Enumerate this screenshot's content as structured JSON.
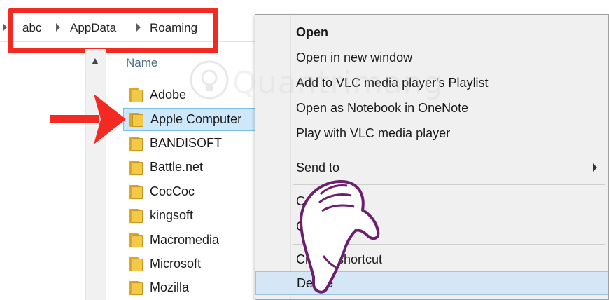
{
  "breadcrumb": {
    "items": [
      "abc",
      "AppData",
      "Roaming"
    ]
  },
  "file_list": {
    "column_header": "Name",
    "items": [
      {
        "name": "Adobe",
        "selected": false
      },
      {
        "name": "Apple Computer",
        "selected": true
      },
      {
        "name": "BANDISOFT",
        "selected": false
      },
      {
        "name": "Battle.net",
        "selected": false
      },
      {
        "name": "CocCoc",
        "selected": false
      },
      {
        "name": "kingsoft",
        "selected": false
      },
      {
        "name": "Macromedia",
        "selected": false
      },
      {
        "name": "Microsoft",
        "selected": false
      },
      {
        "name": "Mozilla",
        "selected": false
      }
    ]
  },
  "context_menu": {
    "items": [
      {
        "label": "Open",
        "bold": true
      },
      {
        "label": "Open in new window"
      },
      {
        "label": "Add to VLC media player's Playlist"
      },
      {
        "label": "Open as Notebook in OneNote"
      },
      {
        "label": "Play with VLC media player"
      },
      {
        "label": "Send to",
        "submenu": true
      },
      {
        "label": "C"
      },
      {
        "label": "C"
      },
      {
        "label": "Create shortcut"
      },
      {
        "label": "Delete",
        "hovered": true
      }
    ]
  },
  "watermark": {
    "text": "Quantrimang"
  },
  "colors": {
    "highlight_red": "#f22a22",
    "selection_bg": "#cde8fb",
    "hover_bg": "#d5e6f7",
    "menu_bg": "#f0f0f0",
    "hand_outline": "#6b1f6e"
  }
}
